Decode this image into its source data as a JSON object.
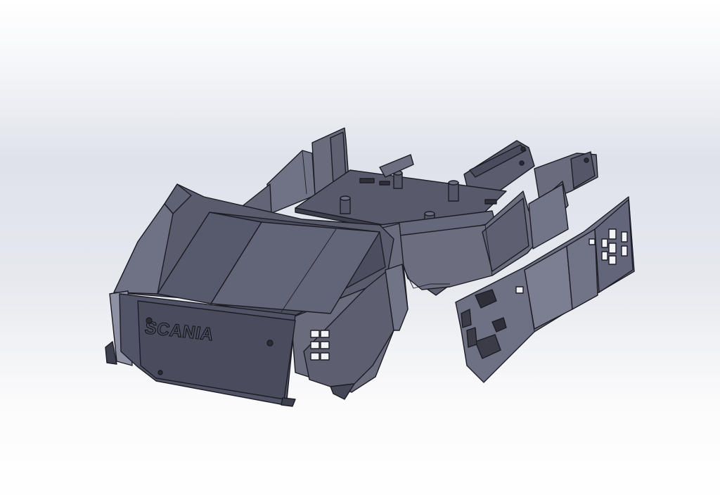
{
  "viewport": {
    "background_top": "#ffffff",
    "background_mid": "#dfe2ea",
    "background_bottom": "#ffffff"
  },
  "model": {
    "logo_text": "SCANIA",
    "colors": {
      "body_dark": "#4e5061",
      "body_mid": "#5b5d6f",
      "body_light": "#777a8c",
      "highlight": "#a6a8ba",
      "edge": "#1c1d24"
    }
  }
}
